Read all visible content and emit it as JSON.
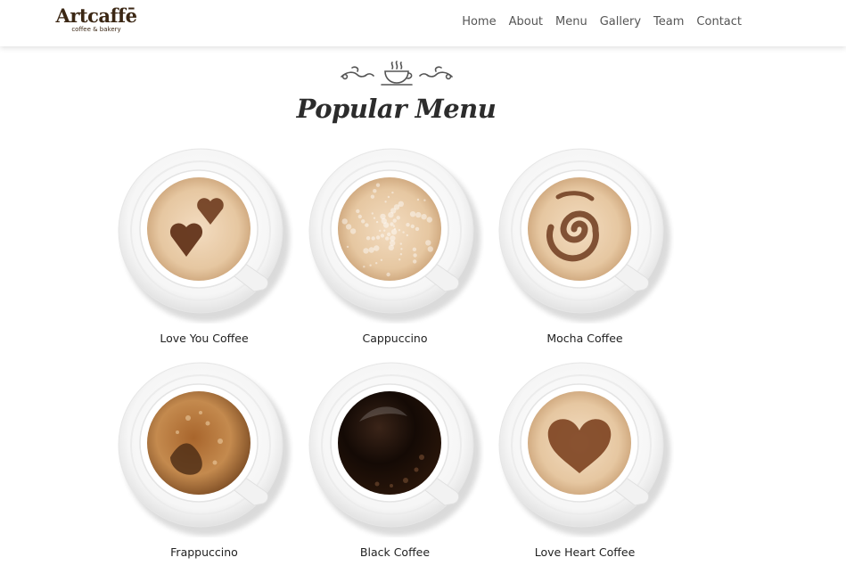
{
  "header": {
    "logo": {
      "name": "Artcaffē",
      "tagline": "coffee & bakery"
    },
    "nav": [
      "Home",
      "About",
      "Menu",
      "Gallery",
      "Team",
      "Contact"
    ]
  },
  "section": {
    "ornament_icon": "coffee-cup-ornament-icon",
    "title": "Popular Menu"
  },
  "menu": [
    {
      "name": "Love You Coffee",
      "art": "two-hearts"
    },
    {
      "name": "Cappuccino",
      "art": "foam"
    },
    {
      "name": "Mocha Coffee",
      "art": "swirl"
    },
    {
      "name": "Frappuccino",
      "art": "crema"
    },
    {
      "name": "Black Coffee",
      "art": "black"
    },
    {
      "name": "Love Heart Coffee",
      "art": "heart"
    }
  ],
  "colors": {
    "brand": "#3b2714",
    "foam": "#e8c9a3",
    "cocoa": "#6e3b1e",
    "black_coffee": "#1a0e08",
    "crema": "#b87d45"
  }
}
